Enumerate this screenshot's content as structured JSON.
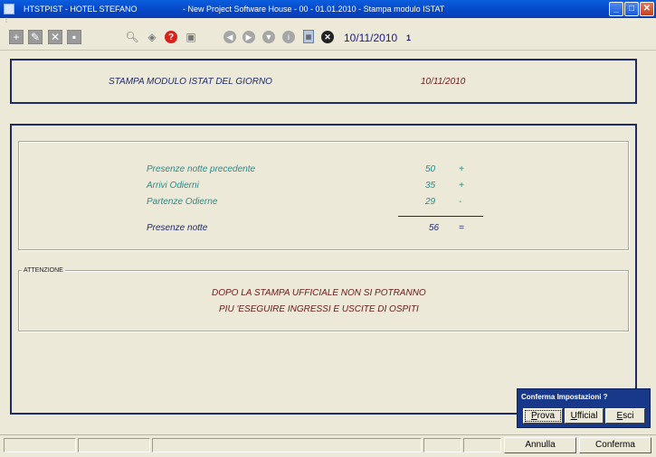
{
  "window": {
    "title_left": "HTSTPIST - HOTEL STEFANO",
    "title_center": "- New Project Software House - 00 - 01.01.2010 - Stampa modulo ISTAT",
    "minimize": "_",
    "maximize": "□",
    "close": "✕"
  },
  "toolbar": {
    "date": "10/11/2010",
    "count": "1"
  },
  "header": {
    "title": "STAMPA MODULO ISTAT DEL GIORNO",
    "date": "10/11/2010"
  },
  "summary": {
    "rows": [
      {
        "label": "Presenze notte precedente",
        "value": "50",
        "op": "+"
      },
      {
        "label": "Arrivi Odierni",
        "value": "35",
        "op": "+"
      },
      {
        "label": "Partenze Odierne",
        "value": "29",
        "op": "-"
      }
    ],
    "total": {
      "label": "Presenze notte",
      "value": "56",
      "op": "="
    }
  },
  "warning": {
    "legend": "ATTENZIONE",
    "line1": "DOPO LA STAMPA UFFICIALE NON SI POTRANNO",
    "line2": "PIU 'ESEGUIRE INGRESSI E USCITE DI OSPITI"
  },
  "dialog": {
    "title": "Conferma Impostazioni ?",
    "prova": {
      "u": "P",
      "rest": "rova"
    },
    "ufficial": {
      "u": "U",
      "rest": "fficial"
    },
    "esci": {
      "u": "E",
      "rest": "sci"
    }
  },
  "statusbar": {
    "annulla": "Annulla",
    "conferma": "Conferma"
  },
  "colors": {
    "navy": "#1e2a6b",
    "teal": "#2a8a8a",
    "darkred": "#6a1a1a",
    "dialog_bg": "#18398a"
  }
}
